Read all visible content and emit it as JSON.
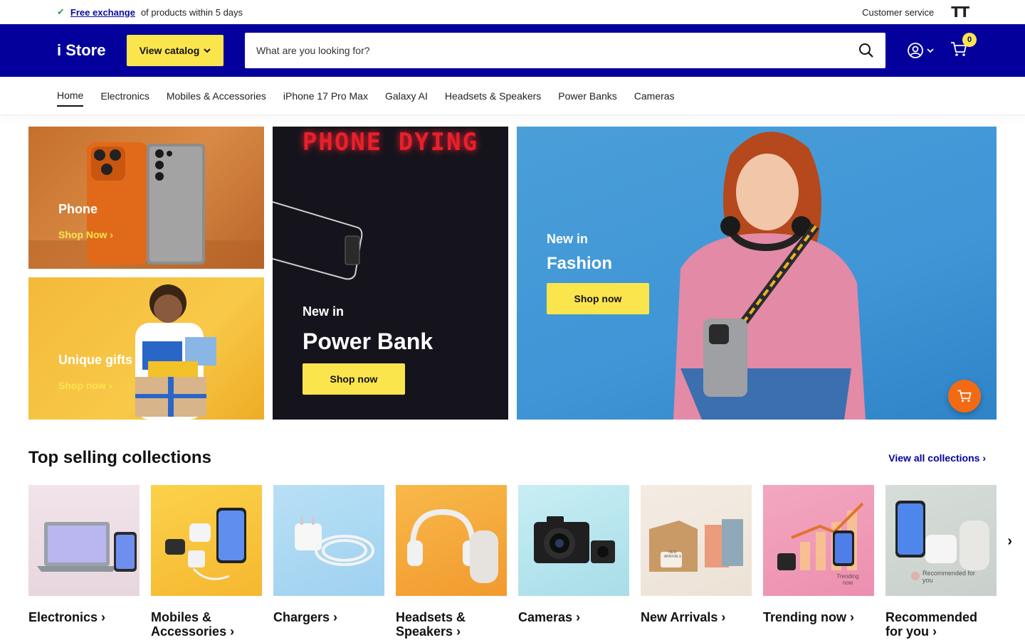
{
  "topbar": {
    "exchange_link": "Free exchange",
    "exchange_text": "of products within 5 days",
    "customer_service": "Customer service"
  },
  "header": {
    "logo": "i Store",
    "catalog_label": "View catalog",
    "search_placeholder": "What are you looking for?",
    "cart_count": "0"
  },
  "nav": {
    "items": [
      "Home",
      "Electronics",
      "Mobiles & Accessories",
      "iPhone 17 Pro Max",
      "Galaxy AI",
      "Headsets & Speakers",
      "Power Banks",
      "Cameras"
    ]
  },
  "hero": {
    "phone": {
      "title": "Phone",
      "link": "Shop Now"
    },
    "gifts": {
      "title": "Unique gifts",
      "link": "Shop now"
    },
    "power": {
      "sign": "PHONE DYING",
      "eyebrow": "New in",
      "title": "Power Bank",
      "button": "Shop now"
    },
    "fashion": {
      "eyebrow": "New in",
      "title": "Fashion",
      "button": "Shop now"
    }
  },
  "collections": {
    "title": "Top selling collections",
    "view_all": "View all collections",
    "items": [
      {
        "name": "Electronics"
      },
      {
        "name": "Mobiles & Accessories"
      },
      {
        "name": "Chargers"
      },
      {
        "name": "Headsets & Speakers"
      },
      {
        "name": "Cameras"
      },
      {
        "name": "New Arrivals",
        "tag": "NEW ARRIVALS"
      },
      {
        "name": "Trending now",
        "tag": "Trending now"
      },
      {
        "name": "Recommended for you",
        "tag": "Recommended for you"
      }
    ]
  },
  "colors": {
    "brand_blue": "#03009c",
    "accent_yellow": "#fbe54d",
    "fab_orange": "#f26a13"
  }
}
